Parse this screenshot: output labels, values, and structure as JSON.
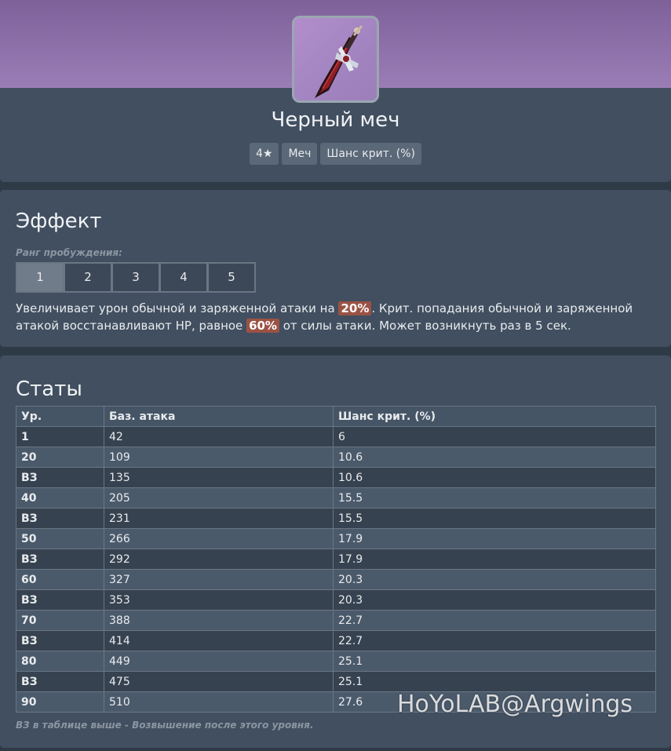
{
  "weapon": {
    "name": "Черный меч",
    "icon": "black-sword-icon",
    "tags": [
      "4★",
      "Меч",
      "Шанс крит. (%)"
    ]
  },
  "effect": {
    "title": "Эффект",
    "refine_label": "Ранг пробуждения:",
    "refine_ranks": [
      "1",
      "2",
      "3",
      "4",
      "5"
    ],
    "active_rank": "1",
    "text_part1": "Увеличивает урон обычной и заряженной атаки на ",
    "value1": "20%",
    "text_part2": ". Крит. попадания обычной и заряженной атакой восстанавливают HP, равное ",
    "value2": "60%",
    "text_part3": " от силы атаки. Может возникнуть раз в 5 сек."
  },
  "stats": {
    "title": "Статы",
    "headers": [
      "Ур.",
      "Баз. атака",
      "Шанс крит. (%)"
    ],
    "rows": [
      [
        "1",
        "42",
        "6"
      ],
      [
        "20",
        "109",
        "10.6"
      ],
      [
        "ВЗ",
        "135",
        "10.6"
      ],
      [
        "40",
        "205",
        "15.5"
      ],
      [
        "ВЗ",
        "231",
        "15.5"
      ],
      [
        "50",
        "266",
        "17.9"
      ],
      [
        "ВЗ",
        "292",
        "17.9"
      ],
      [
        "60",
        "327",
        "20.3"
      ],
      [
        "ВЗ",
        "353",
        "20.3"
      ],
      [
        "70",
        "388",
        "22.7"
      ],
      [
        "ВЗ",
        "414",
        "22.7"
      ],
      [
        "80",
        "449",
        "25.1"
      ],
      [
        "ВЗ",
        "475",
        "25.1"
      ],
      [
        "90",
        "510",
        "27.6"
      ]
    ],
    "footnote": "ВЗ в таблице выше - Возвышение после этого уровня."
  },
  "watermark": "HoYoLAB@Argwings",
  "colors": {
    "header_gradient_top": "#7f619a",
    "header_gradient_bottom": "#9b7db6",
    "card_bg": "#414f60",
    "highlight": "#9b5245"
  }
}
